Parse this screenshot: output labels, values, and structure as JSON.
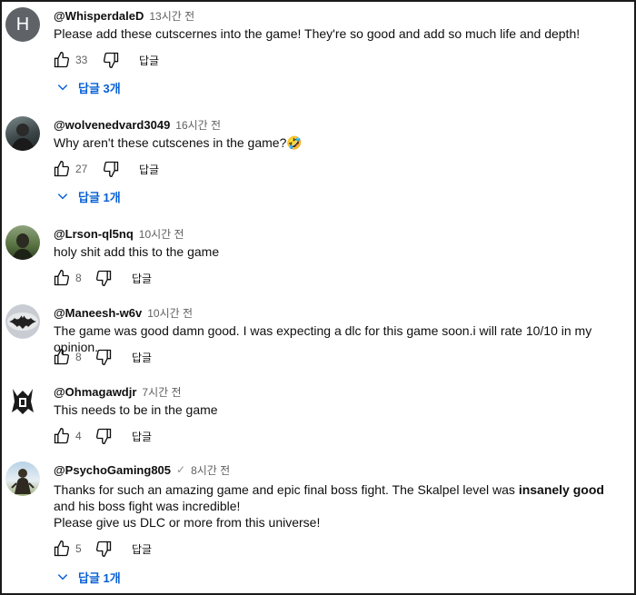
{
  "comments": [
    {
      "author": "@WhisperdaleD",
      "time": "13시간 전",
      "avatar_letter": "H",
      "text": "Please add these cutscernes into the game! They're so good and add so much life and depth!",
      "likes": "33",
      "reply_label": "답글",
      "replies_label": "답글 3개"
    },
    {
      "author": "@wolvenedvard3049",
      "time": "16시간 전",
      "text": "Why aren't these cutscenes in the game?🤣",
      "likes": "27",
      "reply_label": "답글",
      "replies_label": "답글 1개"
    },
    {
      "author": "@Lrson-ql5nq",
      "time": "10시간 전",
      "text": "holy shit add this to the game",
      "likes": "8",
      "reply_label": "답글"
    },
    {
      "author": "@Maneesh-w6v",
      "time": "10시간 전",
      "text": "The game was good damn good. I was expecting a dlc for this game soon.i will rate 10/10 in my opinion.",
      "likes": "8",
      "reply_label": "답글"
    },
    {
      "author": "@Ohmagawdjr",
      "time": "7시간 전",
      "text": "This needs to be in the game",
      "likes": "4",
      "reply_label": "답글"
    },
    {
      "author": "@PsychoGaming805",
      "verified_mark": "✓",
      "time": "8시간 전",
      "text_part1": "Thanks for such an amazing game and epic final boss fight. The Skalpel level was ",
      "text_bold": "insanely good",
      "text_part2": " and his boss fight was incredible!",
      "text_line2": "Please give us DLC or more from this universe!",
      "likes": "5",
      "reply_label": "답글",
      "replies_label": "답글 1개"
    }
  ],
  "colors": {
    "link_blue": "#065fd4",
    "meta_gray": "#606060",
    "letter_avatar": "#5f6368"
  }
}
